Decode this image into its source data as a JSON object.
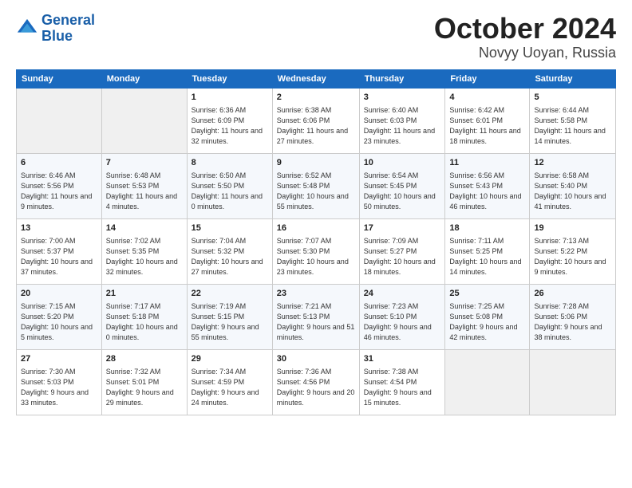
{
  "logo": {
    "line1": "General",
    "line2": "Blue"
  },
  "title": "October 2024",
  "location": "Novyy Uoyan, Russia",
  "weekdays": [
    "Sunday",
    "Monday",
    "Tuesday",
    "Wednesday",
    "Thursday",
    "Friday",
    "Saturday"
  ],
  "weeks": [
    [
      {
        "day": "",
        "info": ""
      },
      {
        "day": "",
        "info": ""
      },
      {
        "day": "1",
        "info": "Sunrise: 6:36 AM\nSunset: 6:09 PM\nDaylight: 11 hours and 32 minutes."
      },
      {
        "day": "2",
        "info": "Sunrise: 6:38 AM\nSunset: 6:06 PM\nDaylight: 11 hours and 27 minutes."
      },
      {
        "day": "3",
        "info": "Sunrise: 6:40 AM\nSunset: 6:03 PM\nDaylight: 11 hours and 23 minutes."
      },
      {
        "day": "4",
        "info": "Sunrise: 6:42 AM\nSunset: 6:01 PM\nDaylight: 11 hours and 18 minutes."
      },
      {
        "day": "5",
        "info": "Sunrise: 6:44 AM\nSunset: 5:58 PM\nDaylight: 11 hours and 14 minutes."
      }
    ],
    [
      {
        "day": "6",
        "info": "Sunrise: 6:46 AM\nSunset: 5:56 PM\nDaylight: 11 hours and 9 minutes."
      },
      {
        "day": "7",
        "info": "Sunrise: 6:48 AM\nSunset: 5:53 PM\nDaylight: 11 hours and 4 minutes."
      },
      {
        "day": "8",
        "info": "Sunrise: 6:50 AM\nSunset: 5:50 PM\nDaylight: 11 hours and 0 minutes."
      },
      {
        "day": "9",
        "info": "Sunrise: 6:52 AM\nSunset: 5:48 PM\nDaylight: 10 hours and 55 minutes."
      },
      {
        "day": "10",
        "info": "Sunrise: 6:54 AM\nSunset: 5:45 PM\nDaylight: 10 hours and 50 minutes."
      },
      {
        "day": "11",
        "info": "Sunrise: 6:56 AM\nSunset: 5:43 PM\nDaylight: 10 hours and 46 minutes."
      },
      {
        "day": "12",
        "info": "Sunrise: 6:58 AM\nSunset: 5:40 PM\nDaylight: 10 hours and 41 minutes."
      }
    ],
    [
      {
        "day": "13",
        "info": "Sunrise: 7:00 AM\nSunset: 5:37 PM\nDaylight: 10 hours and 37 minutes."
      },
      {
        "day": "14",
        "info": "Sunrise: 7:02 AM\nSunset: 5:35 PM\nDaylight: 10 hours and 32 minutes."
      },
      {
        "day": "15",
        "info": "Sunrise: 7:04 AM\nSunset: 5:32 PM\nDaylight: 10 hours and 27 minutes."
      },
      {
        "day": "16",
        "info": "Sunrise: 7:07 AM\nSunset: 5:30 PM\nDaylight: 10 hours and 23 minutes."
      },
      {
        "day": "17",
        "info": "Sunrise: 7:09 AM\nSunset: 5:27 PM\nDaylight: 10 hours and 18 minutes."
      },
      {
        "day": "18",
        "info": "Sunrise: 7:11 AM\nSunset: 5:25 PM\nDaylight: 10 hours and 14 minutes."
      },
      {
        "day": "19",
        "info": "Sunrise: 7:13 AM\nSunset: 5:22 PM\nDaylight: 10 hours and 9 minutes."
      }
    ],
    [
      {
        "day": "20",
        "info": "Sunrise: 7:15 AM\nSunset: 5:20 PM\nDaylight: 10 hours and 5 minutes."
      },
      {
        "day": "21",
        "info": "Sunrise: 7:17 AM\nSunset: 5:18 PM\nDaylight: 10 hours and 0 minutes."
      },
      {
        "day": "22",
        "info": "Sunrise: 7:19 AM\nSunset: 5:15 PM\nDaylight: 9 hours and 55 minutes."
      },
      {
        "day": "23",
        "info": "Sunrise: 7:21 AM\nSunset: 5:13 PM\nDaylight: 9 hours and 51 minutes."
      },
      {
        "day": "24",
        "info": "Sunrise: 7:23 AM\nSunset: 5:10 PM\nDaylight: 9 hours and 46 minutes."
      },
      {
        "day": "25",
        "info": "Sunrise: 7:25 AM\nSunset: 5:08 PM\nDaylight: 9 hours and 42 minutes."
      },
      {
        "day": "26",
        "info": "Sunrise: 7:28 AM\nSunset: 5:06 PM\nDaylight: 9 hours and 38 minutes."
      }
    ],
    [
      {
        "day": "27",
        "info": "Sunrise: 7:30 AM\nSunset: 5:03 PM\nDaylight: 9 hours and 33 minutes."
      },
      {
        "day": "28",
        "info": "Sunrise: 7:32 AM\nSunset: 5:01 PM\nDaylight: 9 hours and 29 minutes."
      },
      {
        "day": "29",
        "info": "Sunrise: 7:34 AM\nSunset: 4:59 PM\nDaylight: 9 hours and 24 minutes."
      },
      {
        "day": "30",
        "info": "Sunrise: 7:36 AM\nSunset: 4:56 PM\nDaylight: 9 hours and 20 minutes."
      },
      {
        "day": "31",
        "info": "Sunrise: 7:38 AM\nSunset: 4:54 PM\nDaylight: 9 hours and 15 minutes."
      },
      {
        "day": "",
        "info": ""
      },
      {
        "day": "",
        "info": ""
      }
    ]
  ]
}
